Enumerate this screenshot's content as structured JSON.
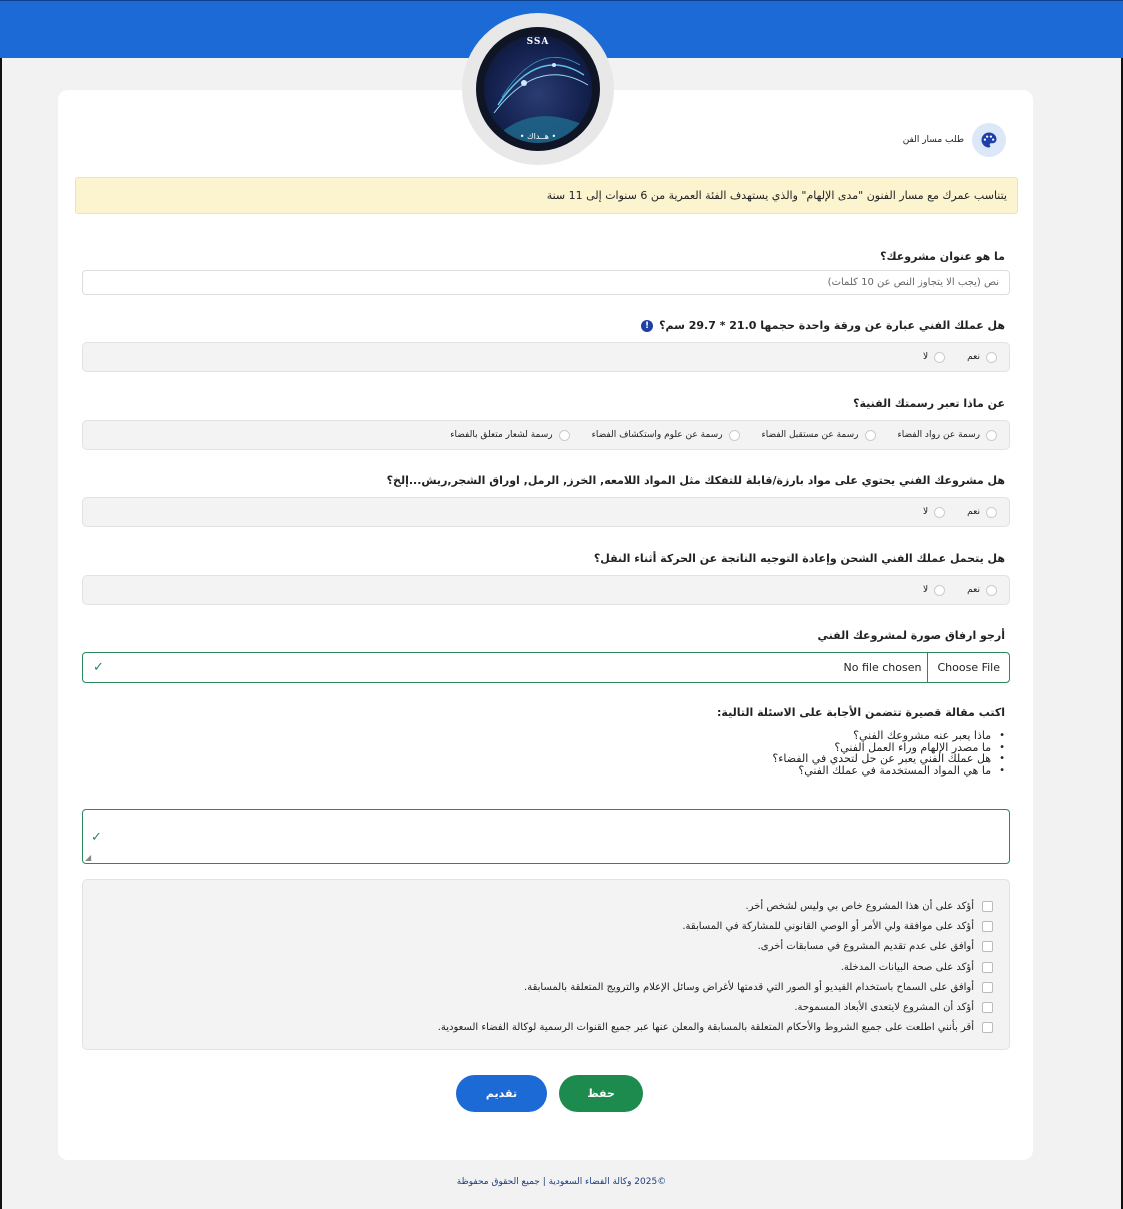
{
  "logo": {
    "top_text": "SSA",
    "bottom_text": "• هــداك •"
  },
  "header": {
    "label": "طلب مسار الفن",
    "icon": "palette-icon"
  },
  "alert": {
    "text": "يتناسب عمرك مع مسار الفنون \"مدى الإلهام\" والذي يستهدف الفئة العمرية من 6 سنوات إلى 11 سنة"
  },
  "q_title": {
    "label": "ما هو عنوان مشروعك؟",
    "placeholder": "نص (يجب ألا يتجاوز النص عن 10 كلمات)"
  },
  "q_size": {
    "label": "هل عملك الفني عبارة عن ورقة واحدة حجمها 21.0 * 29.7 سم؟",
    "options": [
      "نعم",
      "لا"
    ]
  },
  "q_theme": {
    "label": "عن ماذا تعبر رسمتك الفنية؟",
    "options": [
      "رسمة عن رواد الفضاء",
      "رسمة عن مستقبل الفضاء",
      "رسمة عن علوم واستكشاف الفضاء",
      "رسمة لشعار متعلق بالفضاء"
    ]
  },
  "q_materials": {
    "label": "هل مشروعك الفني يحتوي على مواد بارزة/قابلة للتفكك مثل المواد اللامعه, الخرز, الرمل, اوراق الشجر,ريش...إلخ؟",
    "options": [
      "نعم",
      "لا"
    ]
  },
  "q_shipping": {
    "label": "هل يتحمل عملك الفني الشحن وإعادة التوجيه الناتجة عن الحركة أثناء النقل؟",
    "options": [
      "نعم",
      "لا"
    ]
  },
  "q_upload": {
    "label": "أرجو ارفاق صورة لمشروعك الفني",
    "button": "Choose File",
    "status": "No file chosen"
  },
  "q_essay": {
    "label": "اكتب مقالة قصيرة تتضمن الأجابة على الاسئلة التالية:",
    "bullets": [
      "ماذا يعبر عنه مشروعك الفني؟",
      "ما مصدر الإلهام وراء العمل الفني؟",
      "هل عملك الفني يعبر عن حل لتحدي في الفضاء؟",
      "ما هي المواد المستخدمة في عملك الفني؟"
    ]
  },
  "consents": [
    "أؤكد على أن هذا المشروع خاص بي وليس لشخص أخر.",
    "أؤكد على موافقة ولي الأمر أو الوصي القانوني للمشاركة في المسابقة.",
    "أوافق على عدم تقديم المشروع في مسابقات أخرى.",
    "أؤكد على صحة البيانات المدخلة.",
    "أوافق على السماح باستخدام الفيديو أو الصور التي قدمتها لأغراض وسائل الإعلام والترويج المتعلقة بالمسابقة.",
    "أؤكد أن المشروع لايتعدى الأبعاد المسموحة.",
    "أقر بأنني اطلعت على جميع الشروط والأحكام المتعلقة بالمسابقة والمعلن عنها عبر جميع القنوات الرسمية لوكالة الفضاء السعودية."
  ],
  "buttons": {
    "save": "حفظ",
    "submit": "تقديم"
  },
  "footer": {
    "text": "©2025 وكالة الفضاء السعودية | جميع الحقوق محفوظة"
  },
  "colors": {
    "primary": "#1c6ad6",
    "success": "#1d8a4e",
    "alert_bg": "#fcf3cf"
  }
}
